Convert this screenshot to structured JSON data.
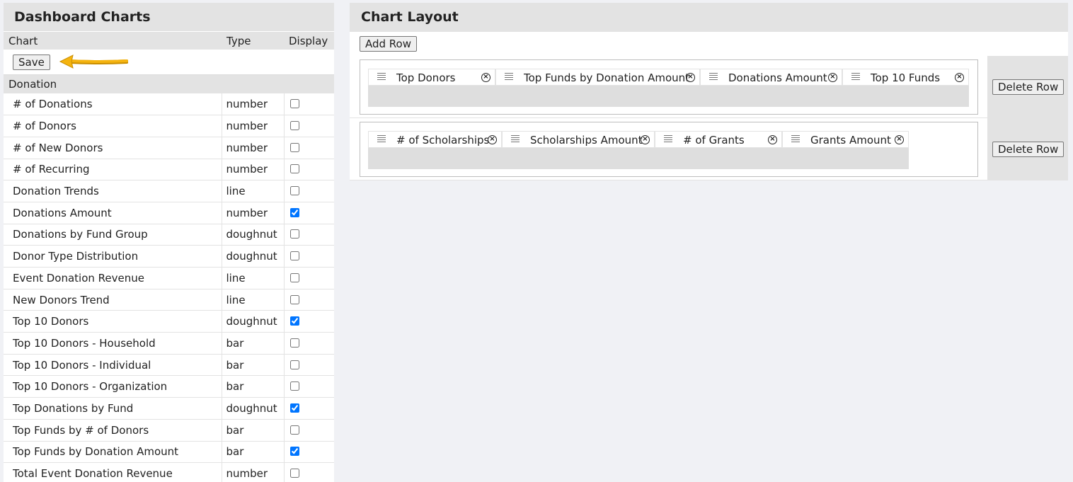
{
  "left": {
    "title": "Dashboard Charts",
    "columns": {
      "chart": "Chart",
      "type": "Type",
      "display": "Display"
    },
    "save_label": "Save",
    "group": "Donation",
    "rows": [
      {
        "name": "# of Donations",
        "type": "number",
        "checked": false
      },
      {
        "name": "# of Donors",
        "type": "number",
        "checked": false
      },
      {
        "name": "# of New Donors",
        "type": "number",
        "checked": false
      },
      {
        "name": "# of Recurring",
        "type": "number",
        "checked": false
      },
      {
        "name": "Donation Trends",
        "type": "line",
        "checked": false
      },
      {
        "name": "Donations Amount",
        "type": "number",
        "checked": true
      },
      {
        "name": "Donations by Fund Group",
        "type": "doughnut",
        "checked": false
      },
      {
        "name": "Donor Type Distribution",
        "type": "doughnut",
        "checked": false
      },
      {
        "name": "Event Donation Revenue",
        "type": "line",
        "checked": false
      },
      {
        "name": "New Donors Trend",
        "type": "line",
        "checked": false
      },
      {
        "name": "Top 10 Donors",
        "type": "doughnut",
        "checked": true
      },
      {
        "name": "Top 10 Donors - Household",
        "type": "bar",
        "checked": false
      },
      {
        "name": "Top 10 Donors - Individual",
        "type": "bar",
        "checked": false
      },
      {
        "name": "Top 10 Donors - Organization",
        "type": "bar",
        "checked": false
      },
      {
        "name": "Top Donations by Fund",
        "type": "doughnut",
        "checked": true
      },
      {
        "name": "Top Funds by # of Donors",
        "type": "bar",
        "checked": false
      },
      {
        "name": "Top Funds by Donation Amount",
        "type": "bar",
        "checked": true
      },
      {
        "name": "Total Event Donation Revenue",
        "type": "number",
        "checked": false
      }
    ]
  },
  "right": {
    "title": "Chart Layout",
    "add_row_label": "Add Row",
    "delete_row_label": "Delete Row",
    "layout_rows": [
      {
        "items": [
          "Top Donors",
          "Top Funds by Donation Amount",
          "Donations Amount",
          "Top 10 Funds"
        ]
      },
      {
        "items": [
          "# of Scholarships",
          "Scholarships Amount",
          "# of Grants",
          "Grants Amount"
        ]
      }
    ]
  },
  "colors": {
    "accent_arrow": "#f5b40f",
    "header_bg": "#e3e3e3",
    "checkbox": "#1a73e8"
  }
}
